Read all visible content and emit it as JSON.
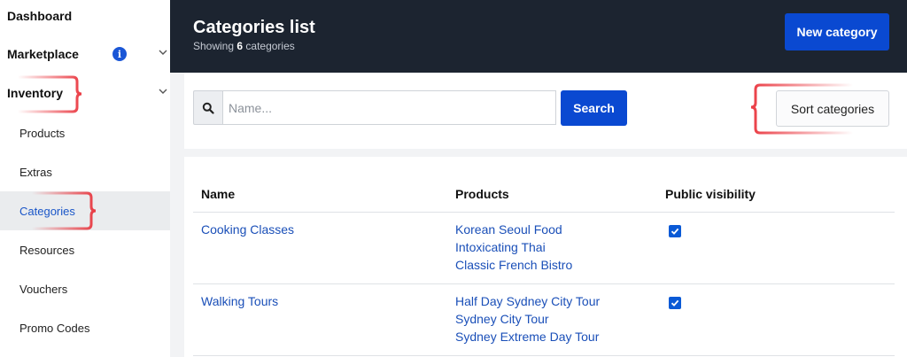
{
  "sidebar": {
    "items": [
      {
        "label": "Dashboard"
      },
      {
        "label": "Marketplace"
      },
      {
        "label": "Inventory"
      },
      {
        "label": "Products"
      },
      {
        "label": "Extras"
      },
      {
        "label": "Categories"
      },
      {
        "label": "Resources"
      },
      {
        "label": "Vouchers"
      },
      {
        "label": "Promo Codes"
      }
    ],
    "active": "Categories",
    "info_glyph": "i"
  },
  "header": {
    "title": "Categories list",
    "subtitle_prefix": "Showing",
    "count": "6",
    "subtitle_suffix": "categories",
    "new_button": "New category"
  },
  "search": {
    "placeholder": "Name...",
    "value": "",
    "button": "Search",
    "sort_button": "Sort categories"
  },
  "table": {
    "columns": [
      "Name",
      "Products",
      "Public visibility"
    ],
    "rows": [
      {
        "name": "Cooking Classes",
        "products": [
          "Korean Seoul Food",
          "Intoxicating Thai",
          "Classic French Bistro"
        ],
        "public_visibility": true
      },
      {
        "name": "Walking Tours",
        "products": [
          "Half Day Sydney City Tour",
          "Sydney City Tour",
          "Sydney Extreme Day Tour"
        ],
        "public_visibility": true
      }
    ]
  },
  "colors": {
    "primary": "#0a49d1",
    "header_bg": "#1c2430",
    "link": "#1a4fb8",
    "annotation": "#e8262f"
  }
}
